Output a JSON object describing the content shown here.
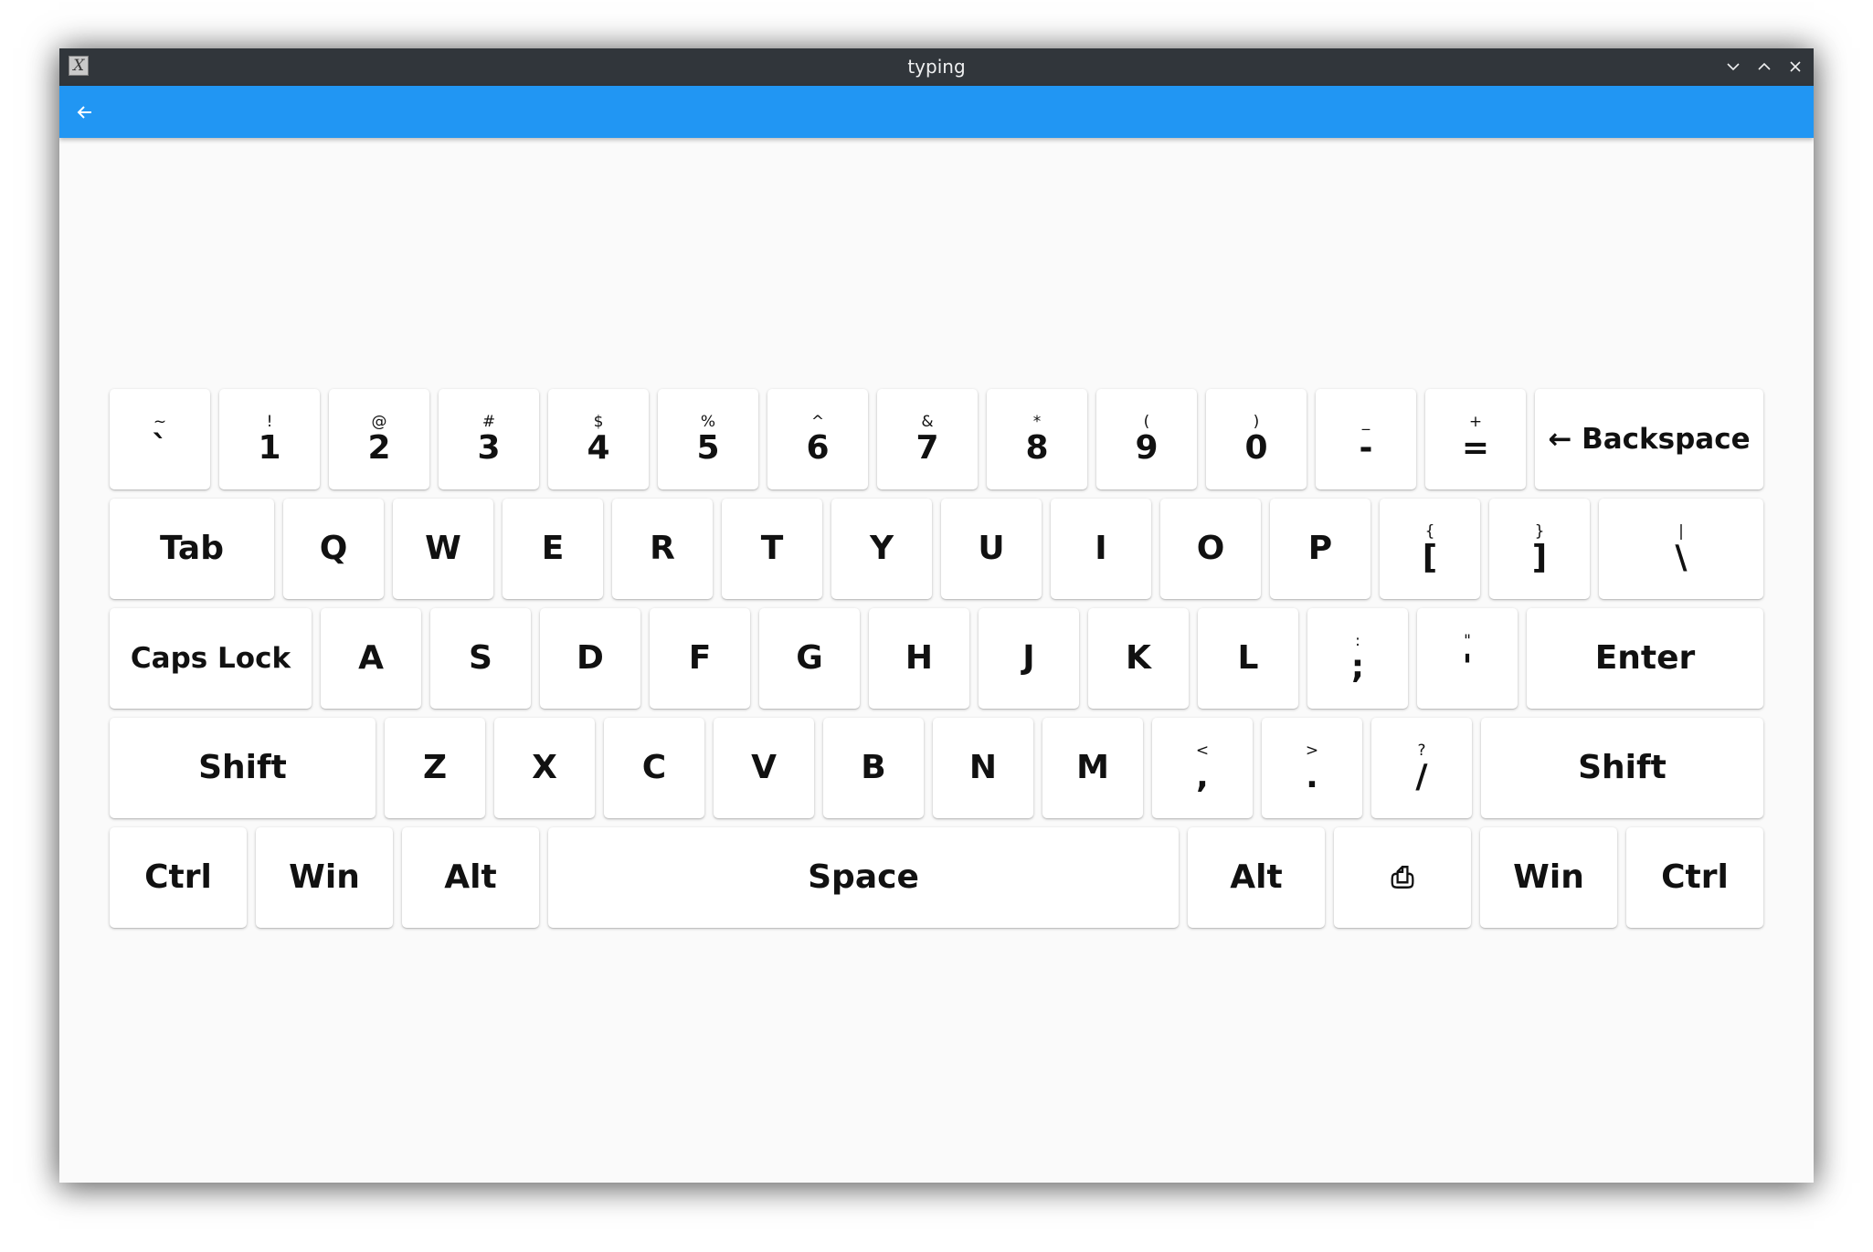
{
  "window": {
    "title": "typing",
    "app_icon_glyph": "X"
  },
  "appbar": {
    "back_icon": "arrow-left-icon",
    "color": "#2196f3"
  },
  "keyboard": {
    "rows": [
      [
        {
          "shift": "~",
          "main": "`"
        },
        {
          "shift": "!",
          "main": "1"
        },
        {
          "shift": "@",
          "main": "2"
        },
        {
          "shift": "#",
          "main": "3"
        },
        {
          "shift": "$",
          "main": "4"
        },
        {
          "shift": "%",
          "main": "5"
        },
        {
          "shift": "^",
          "main": "6"
        },
        {
          "shift": "&",
          "main": "7"
        },
        {
          "shift": "*",
          "main": "8"
        },
        {
          "shift": "(",
          "main": "9"
        },
        {
          "shift": ")",
          "main": "0"
        },
        {
          "shift": "_",
          "main": "-"
        },
        {
          "shift": "+",
          "main": "="
        },
        {
          "label": "← Backspace"
        }
      ],
      [
        {
          "label": "Tab"
        },
        {
          "label": "Q"
        },
        {
          "label": "W"
        },
        {
          "label": "E"
        },
        {
          "label": "R"
        },
        {
          "label": "T"
        },
        {
          "label": "Y"
        },
        {
          "label": "U"
        },
        {
          "label": "I"
        },
        {
          "label": "O"
        },
        {
          "label": "P"
        },
        {
          "shift": "{",
          "main": "["
        },
        {
          "shift": "}",
          "main": "]"
        },
        {
          "shift": "|",
          "main": "\\"
        }
      ],
      [
        {
          "label": "Caps Lock"
        },
        {
          "label": "A"
        },
        {
          "label": "S"
        },
        {
          "label": "D"
        },
        {
          "label": "F"
        },
        {
          "label": "G"
        },
        {
          "label": "H"
        },
        {
          "label": "J"
        },
        {
          "label": "K"
        },
        {
          "label": "L"
        },
        {
          "shift": ":",
          "main": ";"
        },
        {
          "shift": "\"",
          "main": "'"
        },
        {
          "label": "Enter"
        }
      ],
      [
        {
          "label": "Shift"
        },
        {
          "label": "Z"
        },
        {
          "label": "X"
        },
        {
          "label": "C"
        },
        {
          "label": "V"
        },
        {
          "label": "B"
        },
        {
          "label": "N"
        },
        {
          "label": "M"
        },
        {
          "shift": "<",
          "main": ","
        },
        {
          "shift": ">",
          "main": "."
        },
        {
          "shift": "?",
          "main": "/"
        },
        {
          "label": "Shift"
        }
      ],
      [
        {
          "label": "Ctrl"
        },
        {
          "label": "Win"
        },
        {
          "label": "Alt"
        },
        {
          "label": "Space"
        },
        {
          "label": "Alt"
        },
        {
          "label": "⎙"
        },
        {
          "label": "Win"
        },
        {
          "label": "Ctrl"
        }
      ]
    ]
  }
}
